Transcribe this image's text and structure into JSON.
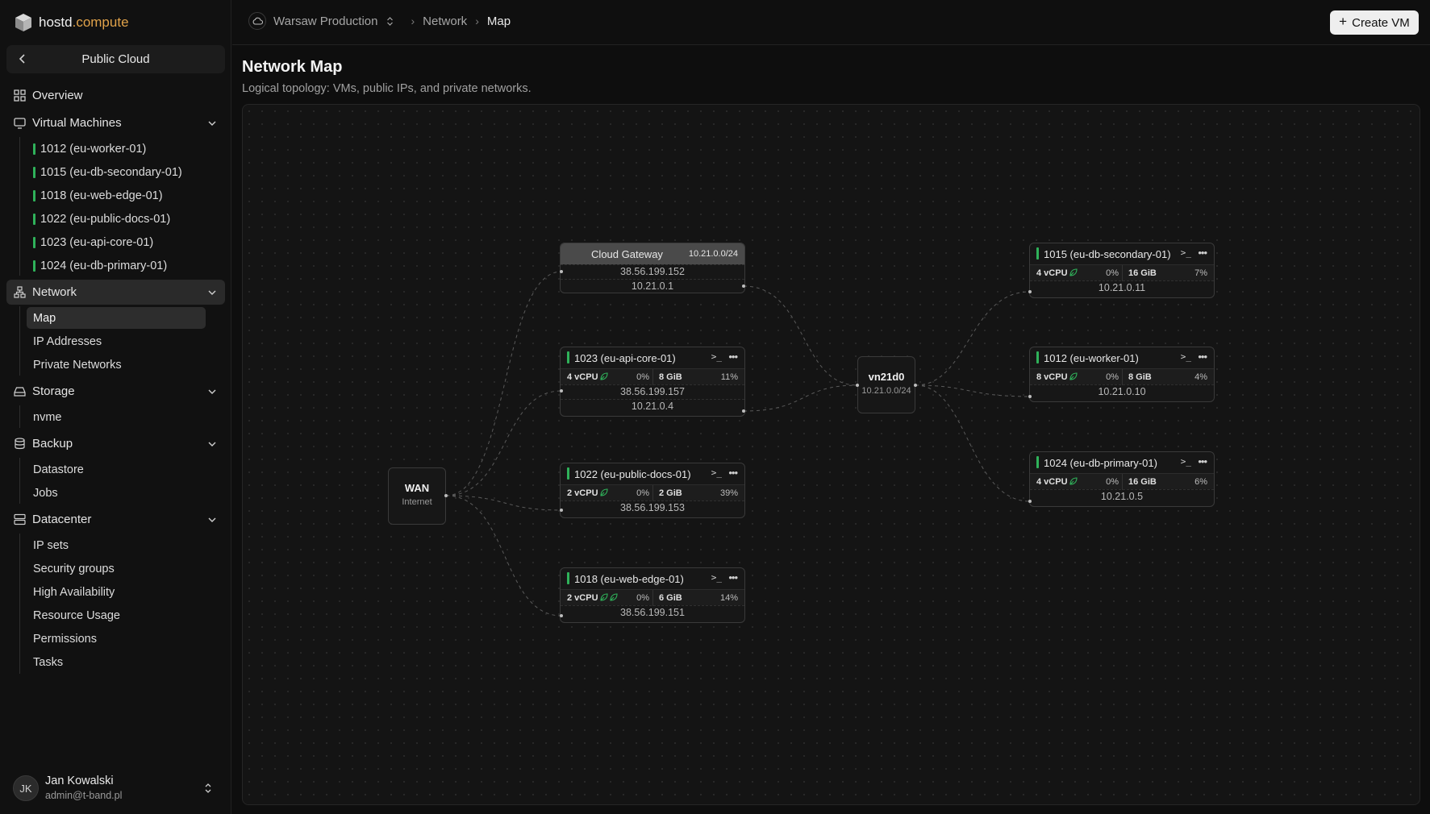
{
  "brand": {
    "name": "hostd",
    "domain": ".compute"
  },
  "cloud_switch": {
    "label": "Public Cloud"
  },
  "sidebar": {
    "overview": "Overview",
    "virtual_machines": {
      "label": "Virtual Machines",
      "items": [
        "1012 (eu-worker-01)",
        "1015 (eu-db-secondary-01)",
        "1018 (eu-web-edge-01)",
        "1022 (eu-public-docs-01)",
        "1023 (eu-api-core-01)",
        "1024 (eu-db-primary-01)"
      ]
    },
    "network": {
      "label": "Network",
      "items": [
        "Map",
        "IP Addresses",
        "Private Networks"
      ]
    },
    "storage": {
      "label": "Storage",
      "items": [
        "nvme"
      ]
    },
    "backup": {
      "label": "Backup",
      "items": [
        "Datastore",
        "Jobs"
      ]
    },
    "datacenter": {
      "label": "Datacenter",
      "items": [
        "IP sets",
        "Security groups",
        "High Availability",
        "Resource Usage",
        "Permissions",
        "Tasks"
      ]
    }
  },
  "user": {
    "initials": "JK",
    "name": "Jan Kowalski",
    "email": "admin@t-band.pl"
  },
  "breadcrumb": {
    "project": "Warsaw Production",
    "section": "Network",
    "page": "Map"
  },
  "create_button": {
    "label": "Create VM"
  },
  "page": {
    "title": "Network Map",
    "subtitle": "Logical topology: VMs, public IPs, and private networks."
  },
  "map": {
    "wan": {
      "title": "WAN",
      "subtitle": "Internet"
    },
    "vnet": {
      "title": "vn21d0",
      "subtitle": "10.21.0.0/24"
    },
    "gateway": {
      "title": "Cloud Gateway",
      "cidr": "10.21.0.0/24",
      "public_ip": "38.56.199.152",
      "private_ip": "10.21.0.1"
    },
    "vms": {
      "api_core": {
        "title": "1023 (eu-api-core-01)",
        "cpu": "4 vCPU",
        "cpu_pct": "0%",
        "mem": "8 GiB",
        "mem_pct": "11%",
        "public_ip": "38.56.199.157",
        "private_ip": "10.21.0.4"
      },
      "public_docs": {
        "title": "1022 (eu-public-docs-01)",
        "cpu": "2 vCPU",
        "cpu_pct": "0%",
        "mem": "2 GiB",
        "mem_pct": "39%",
        "public_ip": "38.56.199.153"
      },
      "web_edge": {
        "title": "1018 (eu-web-edge-01)",
        "cpu": "2 vCPU",
        "cpu_pct": "0%",
        "mem": "6 GiB",
        "mem_pct": "14%",
        "public_ip": "38.56.199.151"
      },
      "db_secondary": {
        "title": "1015 (eu-db-secondary-01)",
        "cpu": "4 vCPU",
        "cpu_pct": "0%",
        "mem": "16 GiB",
        "mem_pct": "7%",
        "private_ip": "10.21.0.11"
      },
      "worker": {
        "title": "1012 (eu-worker-01)",
        "cpu": "8 vCPU",
        "cpu_pct": "0%",
        "mem": "8 GiB",
        "mem_pct": "4%",
        "private_ip": "10.21.0.10"
      },
      "db_primary": {
        "title": "1024 (eu-db-primary-01)",
        "cpu": "4 vCPU",
        "cpu_pct": "0%",
        "mem": "16 GiB",
        "mem_pct": "6%",
        "private_ip": "10.21.0.5"
      }
    },
    "icons": {
      "console": ">_",
      "more": "•••"
    }
  },
  "colors": {
    "status_running": "#2fb25a",
    "accent_domain": "#e0a24a",
    "create_button_bg": "#eeeeee"
  }
}
